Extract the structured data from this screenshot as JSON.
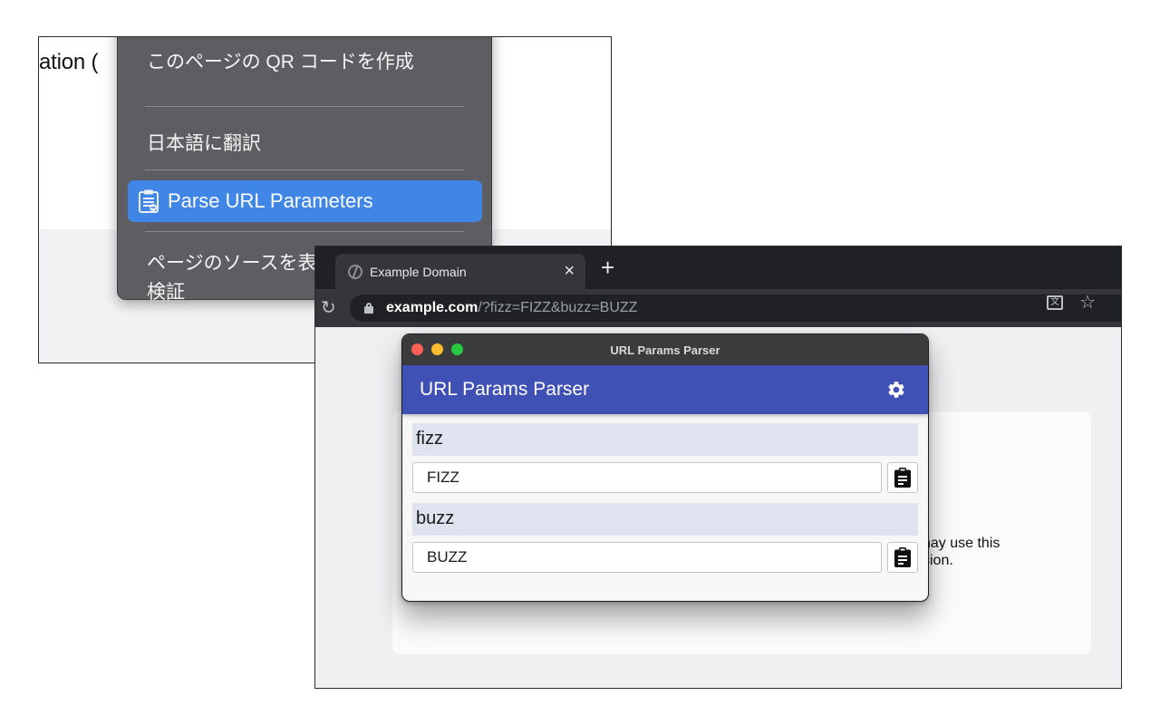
{
  "left_screenshot": {
    "page_text": "ation (",
    "context_menu": {
      "items": [
        {
          "label": "このページの QR コードを作成"
        },
        {
          "label": "日本語に翻訳"
        },
        {
          "label": "Parse URL Parameters",
          "icon": "clipboard-list-icon",
          "highlighted": true
        },
        {
          "label": "ページのソースを表示"
        },
        {
          "label": "検証"
        }
      ]
    }
  },
  "browser": {
    "tab": {
      "title": "Example Domain",
      "close_label": "×",
      "icon": "globe-icon"
    },
    "new_tab_label": "+",
    "address_bar": {
      "host": "example.com",
      "rest": "/?fizz=FIZZ&buzz=BUZZ"
    },
    "page": {
      "visible_text": "nay use this\nsion."
    }
  },
  "popup": {
    "window_title": "URL Params Parser",
    "app_title": "URL Params Parser",
    "settings_icon": "gear-icon",
    "params": [
      {
        "key": "fizz",
        "value": "FIZZ"
      },
      {
        "key": "buzz",
        "value": "BUZZ"
      }
    ],
    "copy_icon": "clipboard-icon"
  },
  "colors": {
    "app_bar": "#3f51b5",
    "menu_highlight": "#3f86e6",
    "param_key_bg": "#dfe2ef"
  }
}
